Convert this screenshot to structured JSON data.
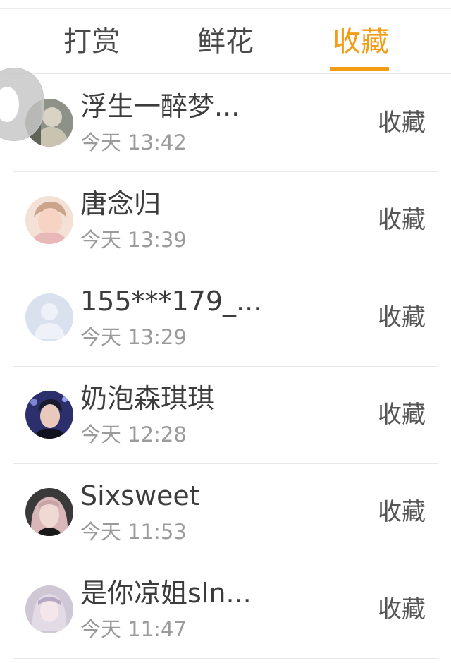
{
  "tabs": [
    {
      "label": "打赏",
      "active": false
    },
    {
      "label": "鲜花",
      "active": false
    },
    {
      "label": "收藏",
      "active": true
    }
  ],
  "colors": {
    "accent": "#f29d15",
    "text": "#3c3c3c",
    "muted": "#9b9b9b"
  },
  "items": [
    {
      "name": "浮生一醉梦...",
      "time": "今天 13:42",
      "action": "收藏",
      "avatar": "user-avatar-1"
    },
    {
      "name": "唐念归",
      "time": "今天 13:39",
      "action": "收藏",
      "avatar": "user-avatar-2"
    },
    {
      "name": "155***179_...",
      "time": "今天 13:29",
      "action": "收藏",
      "avatar": "default-avatar"
    },
    {
      "name": "奶泡森琪琪",
      "time": "今天 12:28",
      "action": "收藏",
      "avatar": "user-avatar-4"
    },
    {
      "name": "Sixsweet",
      "time": "今天 11:53",
      "action": "收藏",
      "avatar": "user-avatar-5"
    },
    {
      "name": "是你凉姐sln...",
      "time": "今天 11:47",
      "action": "收藏",
      "avatar": "user-avatar-6"
    }
  ]
}
